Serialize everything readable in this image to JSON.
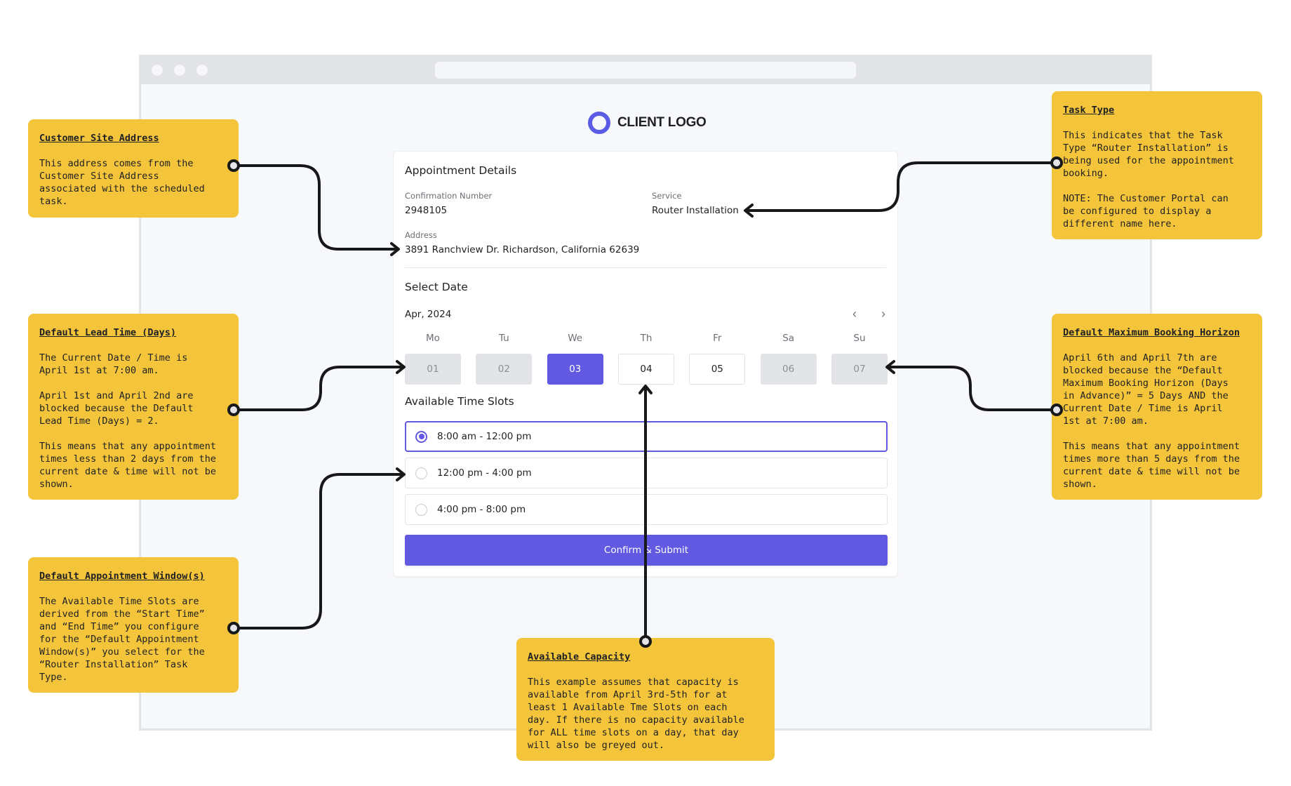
{
  "browser": {
    "window_controls": [
      "close",
      "minimize",
      "maximize"
    ]
  },
  "logo": {
    "icon": "ring-logo-icon",
    "text": "CLIENT LOGO",
    "color": "#5b5ce6"
  },
  "appointment": {
    "title": "Appointment Details",
    "confirmation_label": "Confirmation Number",
    "confirmation_value": "2948105",
    "service_label": "Service",
    "service_value": "Router Installation",
    "address_label": "Address",
    "address_value": "3891 Ranchview Dr. Richardson, California 62639"
  },
  "date_picker": {
    "title": "Select Date",
    "month_label": "Apr, 2024",
    "prev_icon": "‹",
    "next_icon": "›",
    "days": [
      {
        "name": "Mo",
        "date": "01",
        "state": "disabled"
      },
      {
        "name": "Tu",
        "date": "02",
        "state": "disabled"
      },
      {
        "name": "We",
        "date": "03",
        "state": "selected"
      },
      {
        "name": "Th",
        "date": "04",
        "state": "available"
      },
      {
        "name": "Fr",
        "date": "05",
        "state": "available"
      },
      {
        "name": "Sa",
        "date": "06",
        "state": "disabled"
      },
      {
        "name": "Su",
        "date": "07",
        "state": "disabled"
      }
    ]
  },
  "time_slots": {
    "title": "Available Time Slots",
    "slots": [
      {
        "label": "8:00 am - 12:00 pm",
        "selected": true
      },
      {
        "label": "12:00 pm - 4:00 pm",
        "selected": false
      },
      {
        "label": "4:00 pm - 8:00 pm",
        "selected": false
      }
    ]
  },
  "submit_label": "Confirm & Submit",
  "accent_color": "#6159e2",
  "note_color": "#f4c53b",
  "notes": {
    "customer_site": {
      "title": "Customer Site Address",
      "body": "This address comes from the\nCustomer Site Address\nassociated with the scheduled\ntask."
    },
    "lead_time": {
      "title": "Default Lead Time (Days)",
      "body": "The Current Date / Time is\nApril 1st at 7:00 am.\n\nApril 1st and April 2nd are\nblocked because the Default\nLead Time (Days) = 2.\n\nThis means that any appointment\ntimes less than 2 days from the\ncurrent date & time will not be\nshown."
    },
    "appointment_window": {
      "title": "Default Appointment Window(s)",
      "body": "The Available Time Slots are\nderived from the “Start Time”\nand “End Time” you configure\nfor the “Default Appointment\nWindow(s)” you select for the\n“Router Installation” Task\nType."
    },
    "task_type": {
      "title": "Task Type",
      "body": "This indicates that the Task\nType “Router Installation” is\nbeing used for the appointment\nbooking.\n\nNOTE: The Customer Portal can\nbe configured to display a\ndifferent name here."
    },
    "max_horizon": {
      "title": "Default Maximum Booking Horizon",
      "body": "April 6th and April 7th are\nblocked because the “Default\nMaximum Booking Horizon (Days\nin Advance)” = 5 Days AND the\nCurrent Date / Time is April\n1st at 7:00 am.\n\nThis means that any appointment\ntimes more than 5 days from the\ncurrent date & time will not be\nshown."
    },
    "capacity": {
      "title": "Available Capacity",
      "body": "This example assumes that capacity is\navailable from April 3rd-5th for at\nleast 1 Available Tme Slots on each\nday. If there is no capacity available\nfor ALL time slots on a day, that day\nwill also be greyed out."
    }
  }
}
